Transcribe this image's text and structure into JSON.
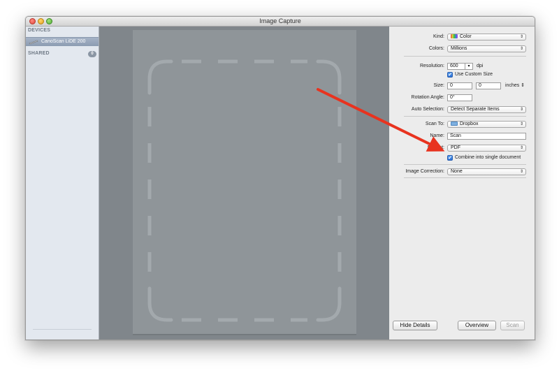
{
  "window": {
    "title": "Image Capture"
  },
  "sidebar": {
    "devices_header": "DEVICES",
    "device_name": "CanoScan LiDE 200",
    "shared_header": "SHARED",
    "shared_count": "0"
  },
  "settings": {
    "kind_label": "Kind:",
    "kind_value": "Color",
    "colors_label": "Colors:",
    "colors_value": "Millions",
    "resolution_label": "Resolution:",
    "resolution_value": "600",
    "resolution_unit": "dpi",
    "use_custom_size_label": "Use Custom Size",
    "size_label": "Size:",
    "size_width": "0",
    "size_height": "0",
    "size_unit": "inches",
    "rotation_label": "Rotation Angle:",
    "rotation_value": "0°",
    "auto_selection_label": "Auto Selection:",
    "auto_selection_value": "Detect Separate Items",
    "scan_to_label": "Scan To:",
    "scan_to_value": "Dropbox",
    "name_label": "Name:",
    "name_value": "Scan",
    "format_label": "Format:",
    "format_value": "PDF",
    "combine_label": "Combine into single document",
    "image_correction_label": "Image Correction:",
    "image_correction_value": "None"
  },
  "buttons": {
    "hide_details": "Hide Details",
    "overview": "Overview",
    "scan": "Scan"
  },
  "colors": {
    "annotation_arrow": "#e8331f",
    "selection_blue": "#2a6fd4"
  },
  "icons": {
    "popup_arrows": "⇕",
    "stepper": "⇕",
    "resolution_dropdown": "▾",
    "checkmark": "✔"
  }
}
